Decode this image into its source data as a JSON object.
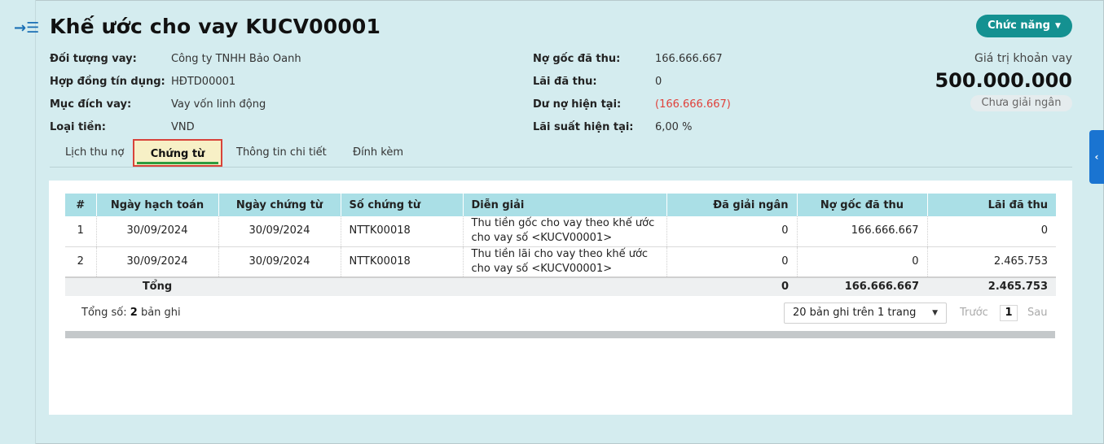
{
  "header": {
    "title": "Khế ước cho vay KUCV00001",
    "func_button": "Chức năng"
  },
  "info_left": [
    {
      "label": "Đối tượng vay:",
      "value": "Công ty TNHH Bảo Oanh"
    },
    {
      "label": "Hợp đồng tín dụng:",
      "value": "HĐTD00001"
    },
    {
      "label": "Mục đích vay:",
      "value": "Vay vốn linh động"
    },
    {
      "label": "Loại tiền:",
      "value": "VND"
    }
  ],
  "info_right": [
    {
      "label": "Nợ gốc đã thu:",
      "value": "166.666.667"
    },
    {
      "label": "Lãi đã thu:",
      "value": "0"
    },
    {
      "label": "Dư nợ hiện tại:",
      "value": "(166.666.667)"
    },
    {
      "label": "Lãi suất hiện tại:",
      "value": "6,00 %"
    }
  ],
  "loan": {
    "label": "Giá trị khoản vay",
    "value": "500.000.000",
    "status": "Chưa giải ngân"
  },
  "tabs": [
    {
      "label": "Lịch thu nợ"
    },
    {
      "label": "Chứng từ"
    },
    {
      "label": "Thông tin chi tiết"
    },
    {
      "label": "Đính kèm"
    }
  ],
  "table": {
    "headers": [
      "#",
      "Ngày hạch toán",
      "Ngày chứng từ",
      "Số chứng từ",
      "Diễn giải",
      "Đã giải ngân",
      "Nợ gốc đã thu",
      "Lãi đã thu"
    ],
    "rows": [
      {
        "no": "1",
        "posting_date": "30/09/2024",
        "doc_date": "30/09/2024",
        "doc_no": "NTTK00018",
        "desc": "Thu tiền gốc cho vay theo khế ước cho vay số <KUCV00001>",
        "disbursed": "0",
        "principal": "166.666.667",
        "interest": "0"
      },
      {
        "no": "2",
        "posting_date": "30/09/2024",
        "doc_date": "30/09/2024",
        "doc_no": "NTTK00018",
        "desc": "Thu tiền lãi cho vay theo khế ước cho vay số <KUCV00001>",
        "disbursed": "0",
        "principal": "0",
        "interest": "2.465.753"
      }
    ],
    "total": {
      "label": "Tổng",
      "disbursed": "0",
      "principal": "166.666.667",
      "interest": "2.465.753"
    }
  },
  "footer": {
    "count_label": "Tổng số:",
    "count": "2",
    "count_unit": "bản ghi",
    "page_size": "20 bản ghi trên 1 trang",
    "prev": "Trước",
    "page": "1",
    "next": "Sau"
  }
}
